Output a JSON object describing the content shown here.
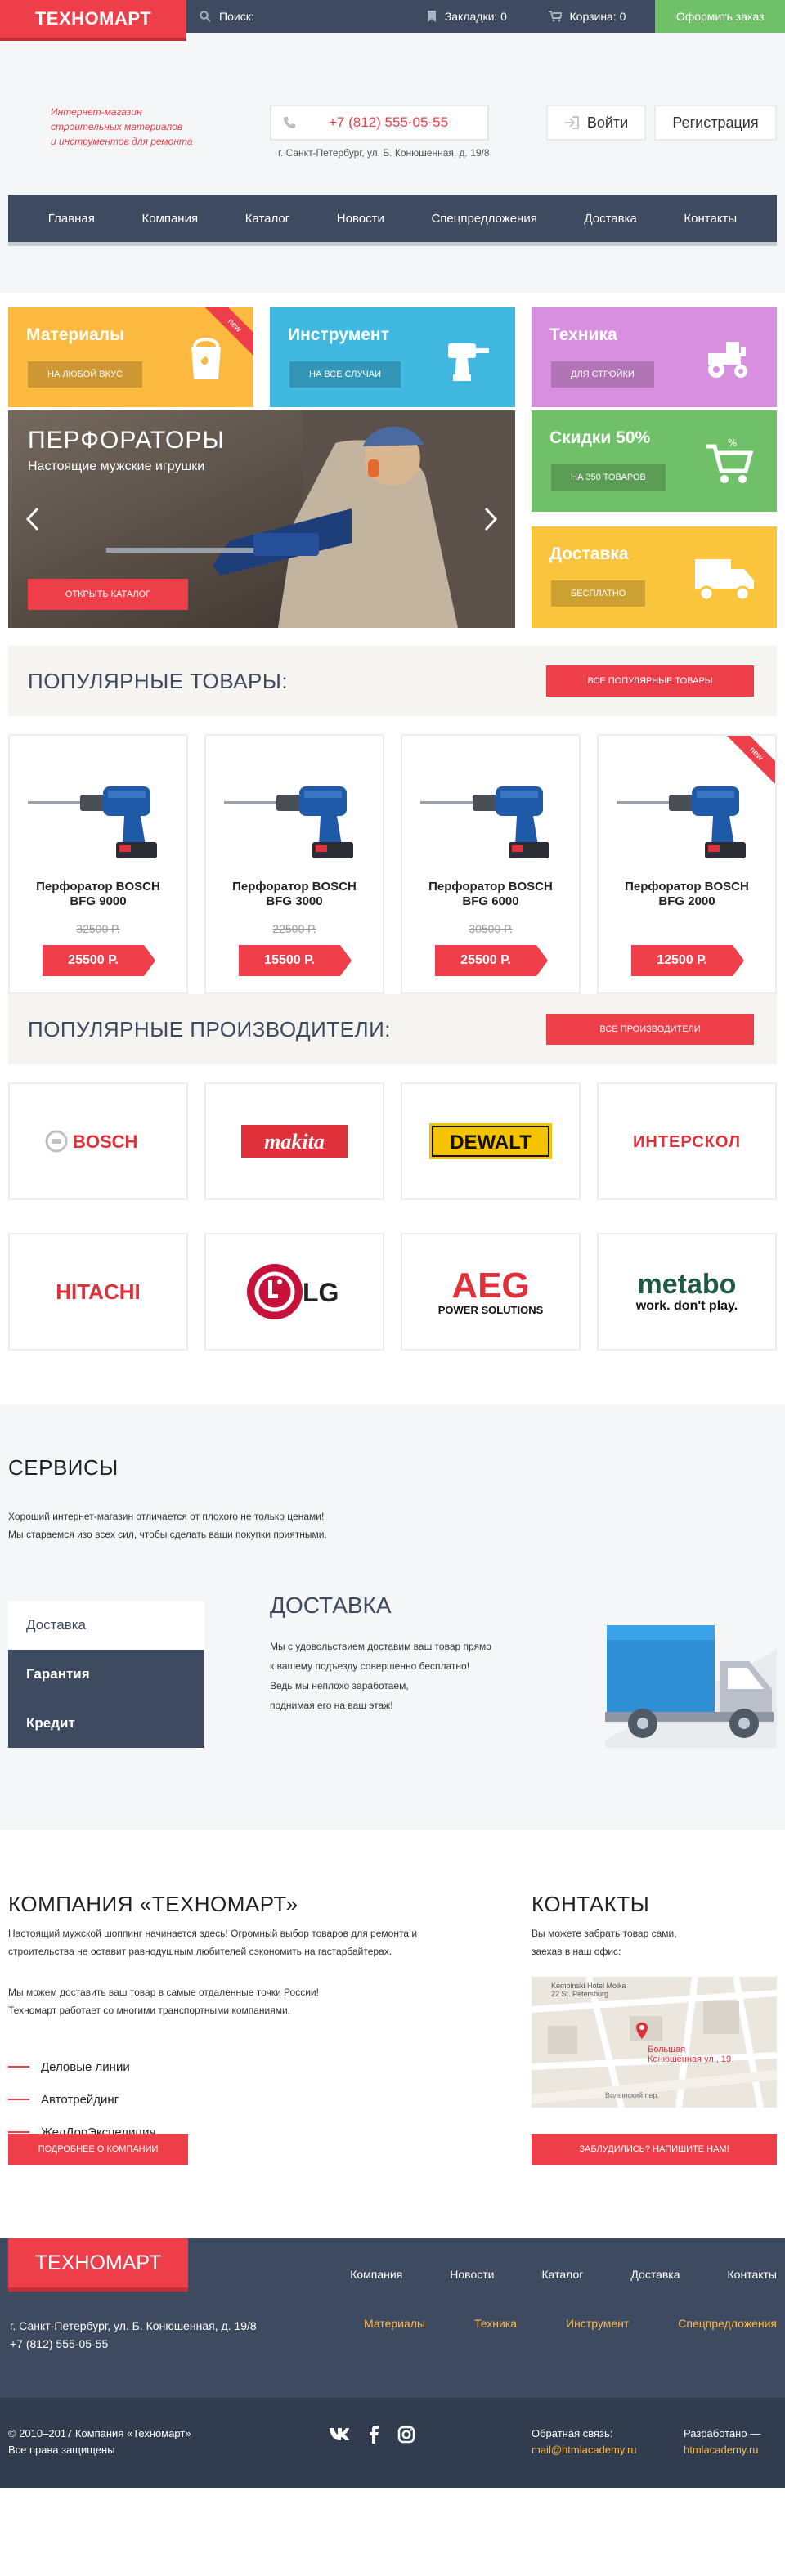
{
  "topbar": {
    "logo": "ТЕХНОМАРТ",
    "search_placeholder": "Поиск:",
    "bookmarks": "Закладки: 0",
    "cart": "Корзина: 0",
    "order": "Оформить заказ"
  },
  "header": {
    "tagline": [
      "Интернет-магазин",
      "строительных материалов",
      "и инструментов для ремонта"
    ],
    "phone": "+7 (812) 555-05-55",
    "address": "г. Санкт-Петербург, ул. Б. Конюшенная, д. 19/8",
    "login": "Войти",
    "register": "Регистрация"
  },
  "nav": [
    "Главная",
    "Компания",
    "Каталог",
    "Новости",
    "Спецпредложения",
    "Доставка",
    "Контакты"
  ],
  "categories": {
    "materials": {
      "title": "Материалы",
      "button": "НА ЛЮБОЙ ВКУС",
      "ribbon": "new",
      "color": "#fbb93f"
    },
    "tools": {
      "title": "Инструмент",
      "button": "НА ВСЕ СЛУЧАИ",
      "color": "#40b8e0"
    },
    "machinery": {
      "title": "Техника",
      "button": "ДЛЯ СТРОЙКИ",
      "color": "#d88fdf"
    },
    "discount": {
      "title": "Скидки 50%",
      "button": "НА 350 ТОВАРОВ",
      "color": "#6fc068"
    },
    "delivery": {
      "title": "Доставка",
      "button": "БЕСПЛАТНО",
      "color": "#fbc43d"
    }
  },
  "hero": {
    "title": "ПЕРФОРАТОРЫ",
    "subtitle": "Настоящие мужские игрушки",
    "button": "ОТКРЫТЬ КАТАЛОГ"
  },
  "popular": {
    "title": "ПОПУЛЯРНЫЕ ТОВАРЫ:",
    "button": "ВСЕ ПОПУЛЯРНЫЕ ТОВАРЫ",
    "items": [
      {
        "name": "Перфоратор BOSCH BFG 9000",
        "old": "32500 Р.",
        "price": "25500 Р.",
        "ribbon": ""
      },
      {
        "name": "Перфоратор BOSCH BFG 3000",
        "old": "22500 Р.",
        "price": "15500 Р.",
        "ribbon": ""
      },
      {
        "name": "Перфоратор BOSCH BFG 6000",
        "old": "30500 Р.",
        "price": "25500 Р.",
        "ribbon": ""
      },
      {
        "name": "Перфоратор BOSCH BFG 2000",
        "old": "",
        "price": "12500 Р.",
        "ribbon": "new"
      }
    ]
  },
  "brands": {
    "title": "ПОПУЛЯРНЫЕ ПРОИЗВОДИТЕЛИ:",
    "button": "ВСЕ ПРОИЗВОДИТЕЛИ",
    "bosch": "BOSCH",
    "makita": "makita",
    "dewalt": "DEWALT",
    "interskol": "ИНТЕРСКОЛ",
    "hitachi": "HITACHI",
    "lg": "LG",
    "aeg": "AEG",
    "aeg_sub": "POWER SOLUTIONS",
    "metabo": "metabo",
    "metabo_sub": "work. don't play."
  },
  "services": {
    "title": "СЕРВИСЫ",
    "intro": [
      "Хороший интернет-магазин отличается от плохого не только ценами!",
      "Мы стараемся изо всех сил, чтобы сделать ваши покупки приятными."
    ],
    "tabs": [
      "Доставка",
      "Гарантия",
      "Кредит"
    ],
    "content_title": "ДОСТАВКА",
    "content": [
      "Мы с удовольствием доставим ваш товар прямо",
      "к вашему подъезду совершенно бесплатно!",
      "Ведь мы неплохо заработаем,",
      "поднимая его на ваш этаж!"
    ]
  },
  "company": {
    "title": "КОМПАНИЯ «ТЕХНОМАРТ»",
    "p1": [
      "Настоящий мужской шоппинг начинается здесь! Огромный выбор товаров для ремонта и",
      "строительства не оставит равнодушным любителей сэкономить на гастарбайтерах."
    ],
    "p2": [
      "Мы можем доставить ваш товар в самые отдаленные точки России!",
      "Техномарт работает со многими транспортными компаниями:"
    ],
    "partners": [
      "Деловые линии",
      "Автотрейдинг",
      "ЖелДорЭкспедиция"
    ],
    "button": "ПОДРОБНЕЕ О КОМПАНИИ"
  },
  "contacts": {
    "title": "КОНТАКТЫ",
    "text": [
      "Вы можете забрать товар сами,",
      "заехав в наш офис:"
    ],
    "map_hotel": "Kempinski Hotel Moika",
    "map_hotel2": "22 St. Petersburg",
    "map_addr1": "Большая",
    "map_addr2": "Конюшенная ул., 19",
    "map_street": "Волынский пер.",
    "button": "ЗАБЛУДИЛИСЬ? НАПИШИТЕ НАМ!"
  },
  "footer": {
    "logo": "ТЕХНОМАРТ",
    "nav": [
      "Компания",
      "Новости",
      "Каталог",
      "Доставка",
      "Контакты"
    ],
    "address": "г. Санкт-Петербург, ул. Б. Конюшенная, д. 19/8",
    "phone": "+7 (812) 555-05-55",
    "cats": [
      "Материалы",
      "Техника",
      "Инструмент",
      "Спецпредложения"
    ],
    "copyright": [
      "© 2010–2017 Компания «Техномарт»",
      "Все права защищены"
    ],
    "feedback_label": "Обратная связь:",
    "feedback_email": "mail@htmlacademy.ru",
    "dev_label": "Разработано —",
    "dev_link": "htmlacademy.ru"
  },
  "colors": {
    "accent": "#ee3e4a",
    "dark": "#3d4a60",
    "green": "#6fc068",
    "light": "#f4f6f7",
    "link": "#f7b94b"
  }
}
